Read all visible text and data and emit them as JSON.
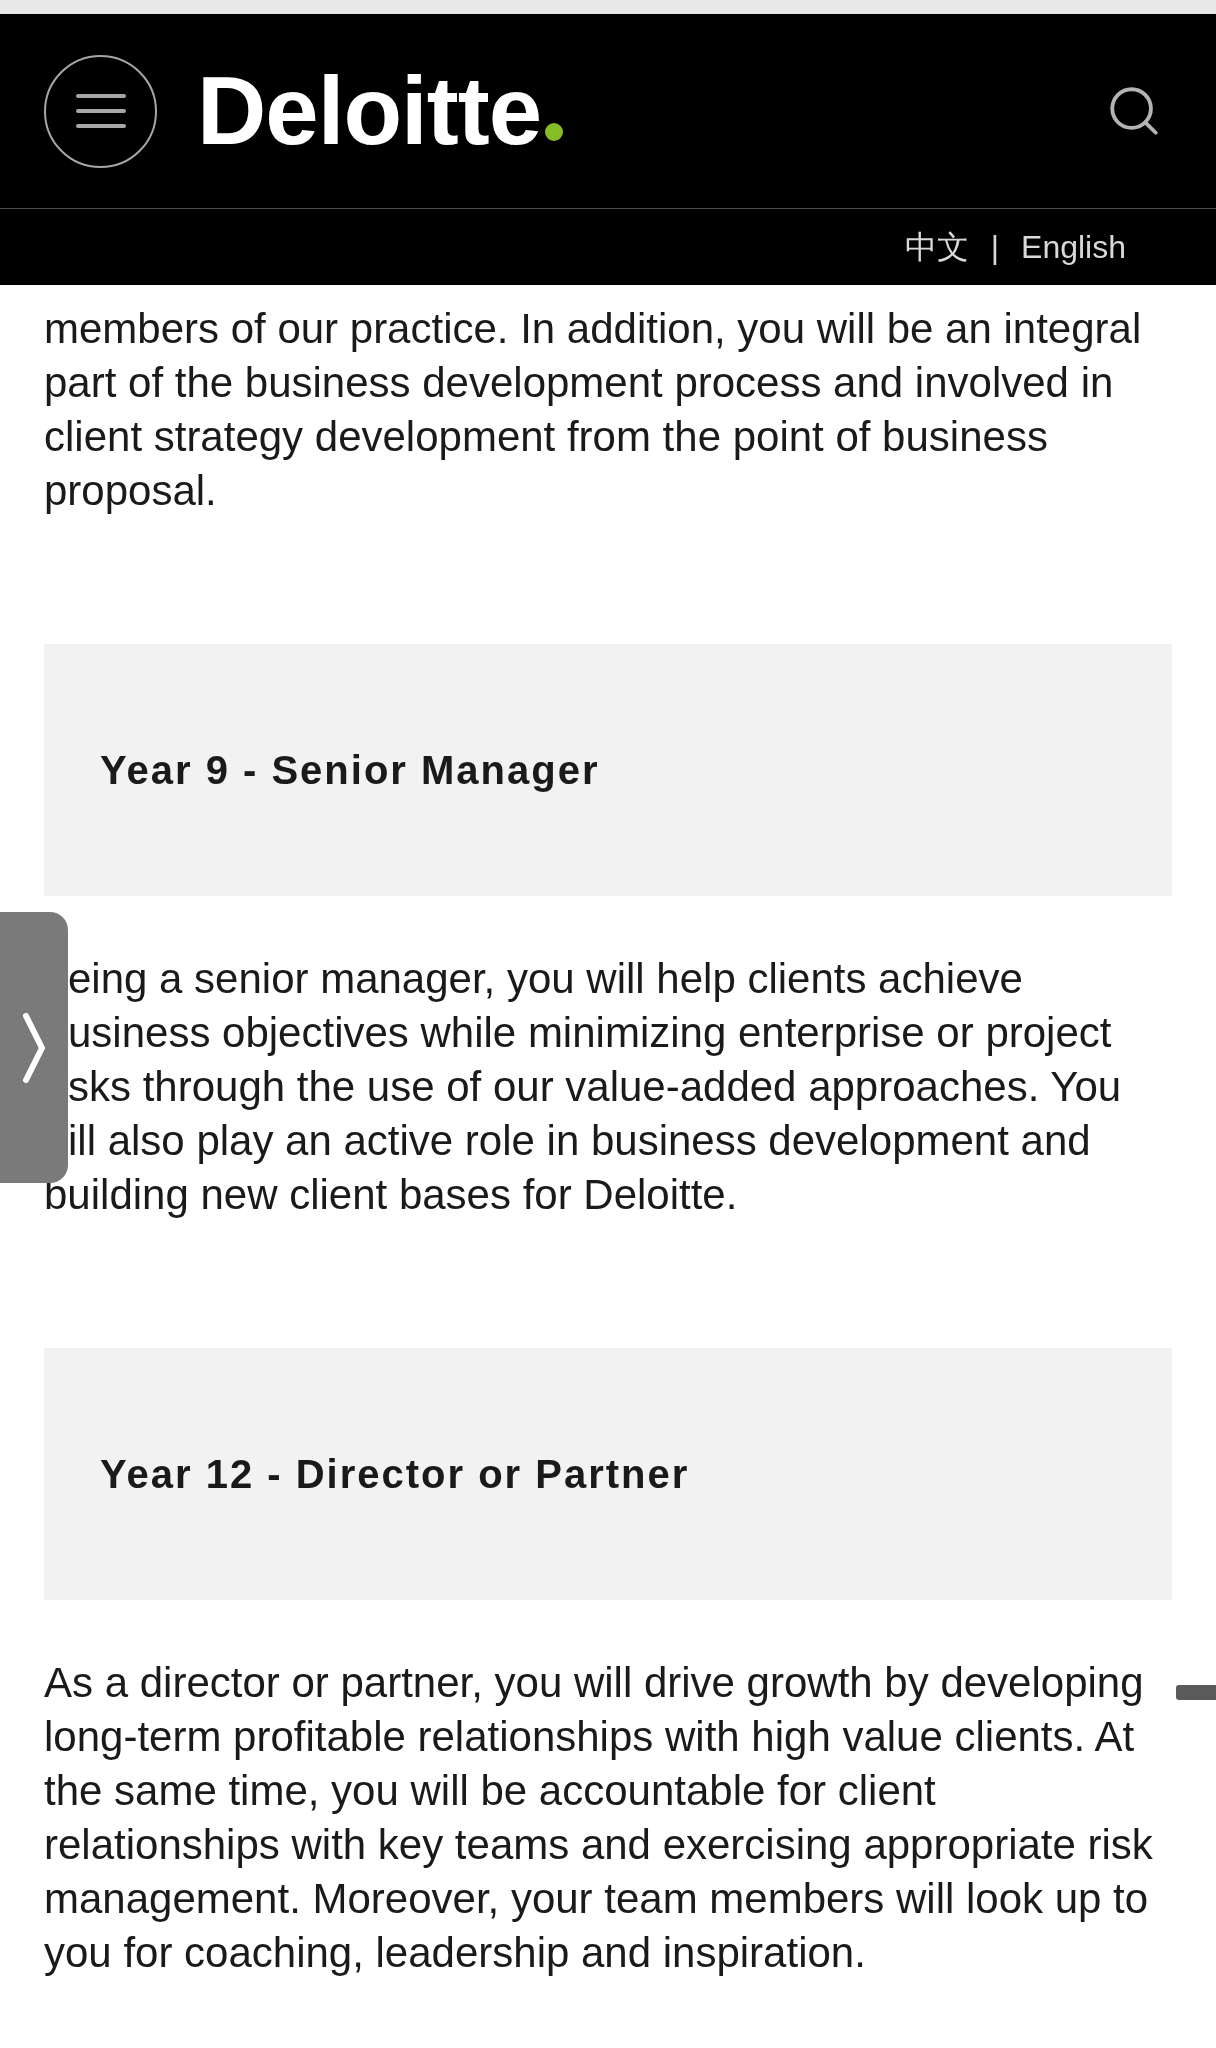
{
  "header": {
    "logo_text": "Deloitte"
  },
  "language_bar": {
    "options": [
      {
        "label": "中文"
      },
      {
        "label": "English"
      }
    ],
    "separator": "|"
  },
  "content": [
    {
      "kind": "paragraph",
      "lines": [
        {
          "text": "members of our practice. In addition, you will be an integral",
          "clipped": false
        },
        {
          "text": "part of the business development process and involved in",
          "clipped": false
        },
        {
          "text": "client strategy development from the point of business",
          "clipped": false
        },
        {
          "text": "proposal.",
          "clipped": false
        }
      ]
    },
    {
      "kind": "heading_card",
      "title": "Year 9 - Senior Manager"
    },
    {
      "kind": "paragraph",
      "lines": [
        {
          "text": "eing a senior manager, you will help clients achieve",
          "clipped": true
        },
        {
          "text": "usiness objectives while minimizing enterprise or project",
          "clipped": true
        },
        {
          "text": "sks through the use of our value-added approaches. You",
          "clipped": true
        },
        {
          "text": "ill also play an active role in business development and",
          "clipped": true
        },
        {
          "text": "building new client bases for Deloitte.",
          "clipped": false
        }
      ]
    },
    {
      "kind": "heading_card",
      "title": "Year 12 - Director or Partner"
    },
    {
      "kind": "paragraph",
      "lines": [
        {
          "text": "As a director or partner, you will drive growth by developing",
          "clipped": false
        },
        {
          "text": "long-term profitable relationships with high value clients. At",
          "clipped": false
        },
        {
          "text": "the same time, you will be accountable for client",
          "clipped": false
        },
        {
          "text": "relationships with key teams and exercising appropriate risk",
          "clipped": false
        },
        {
          "text": "management. Moreover, your team members will look up to",
          "clipped": false
        },
        {
          "text": "you for coaching, leadership and inspiration.",
          "clipped": false
        }
      ]
    }
  ]
}
